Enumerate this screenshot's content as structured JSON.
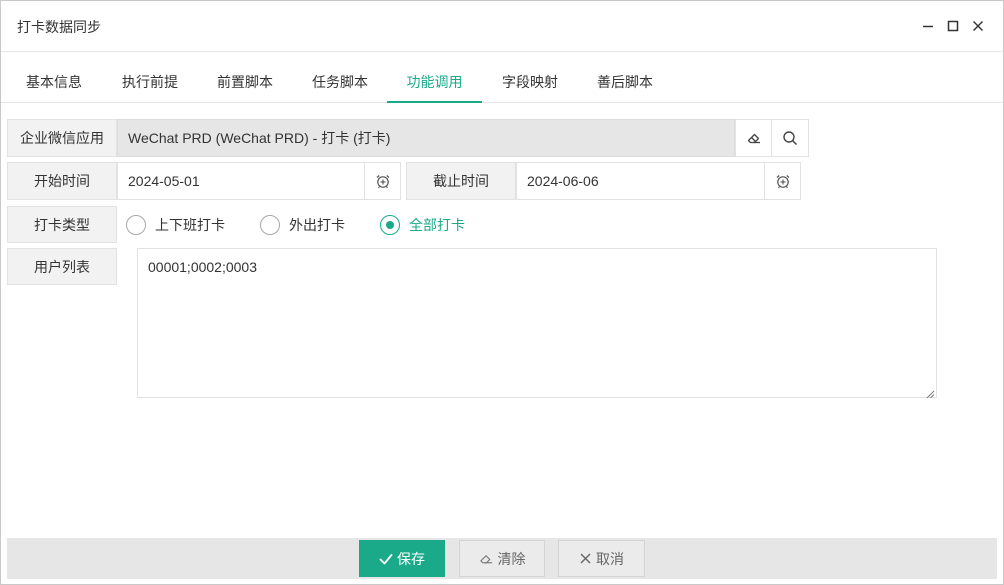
{
  "window": {
    "title": "打卡数据同步"
  },
  "tabs": [
    {
      "label": "基本信息"
    },
    {
      "label": "执行前提"
    },
    {
      "label": "前置脚本"
    },
    {
      "label": "任务脚本"
    },
    {
      "label": "功能调用",
      "active": true
    },
    {
      "label": "字段映射"
    },
    {
      "label": "善后脚本"
    }
  ],
  "form": {
    "app_label": "企业微信应用",
    "app_value": "WeChat PRD (WeChat PRD) - 打卡 (打卡)",
    "start_label": "开始时间",
    "start_value": "2024-05-01",
    "end_label": "截止时间",
    "end_value": "2024-06-06",
    "type_label": "打卡类型",
    "type_options": [
      {
        "label": "上下班打卡",
        "checked": false
      },
      {
        "label": "外出打卡",
        "checked": false
      },
      {
        "label": "全部打卡",
        "checked": true
      }
    ],
    "users_label": "用户列表",
    "users_value": "00001;0002;0003"
  },
  "footer": {
    "save_label": "保存",
    "clear_label": "清除",
    "cancel_label": "取消"
  },
  "colors": {
    "accent": "#1aaa8a"
  },
  "icons": [
    "minimize-icon",
    "maximize-icon",
    "close-icon",
    "eraser-icon",
    "search-icon",
    "alarm-clock-icon",
    "check-icon",
    "x-icon"
  ]
}
